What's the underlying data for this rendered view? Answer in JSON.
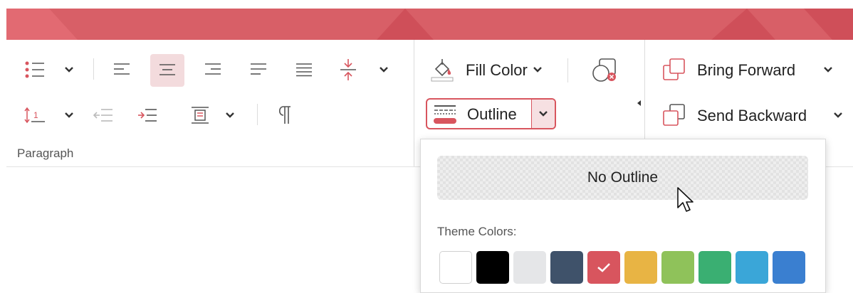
{
  "colors": {
    "accent": "#d8555e",
    "titlebar": "#d85f67"
  },
  "paragraph": {
    "group_label": "Paragraph",
    "icons": [
      "bullet-list-icon",
      "align-left-icon",
      "align-center-icon",
      "align-right-icon",
      "justify-icon",
      "distributed-icon",
      "text-spacing-icon",
      "line-spacing-icon",
      "decrease-indent-icon",
      "increase-indent-icon",
      "text-box-icon",
      "pilcrow-icon"
    ]
  },
  "shape": {
    "fill_color_label": "Fill Color",
    "outline_label": "Outline"
  },
  "arrange": {
    "bring_forward_label": "Bring Forward",
    "send_backward_label": "Send Backward"
  },
  "outline_dropdown": {
    "no_outline_label": "No Outline",
    "theme_colors_label": "Theme Colors:",
    "swatches": [
      {
        "color": "#ffffff",
        "selected": false
      },
      {
        "color": "#000000",
        "selected": false
      },
      {
        "color": "#e5e6e8",
        "selected": false
      },
      {
        "color": "#3f526a",
        "selected": false
      },
      {
        "color": "#d8555e",
        "selected": true
      },
      {
        "color": "#e8b444",
        "selected": false
      },
      {
        "color": "#8fc25a",
        "selected": false
      },
      {
        "color": "#3aaf72",
        "selected": false
      },
      {
        "color": "#3aa6d8",
        "selected": false
      },
      {
        "color": "#3a7fd0",
        "selected": false
      }
    ]
  }
}
